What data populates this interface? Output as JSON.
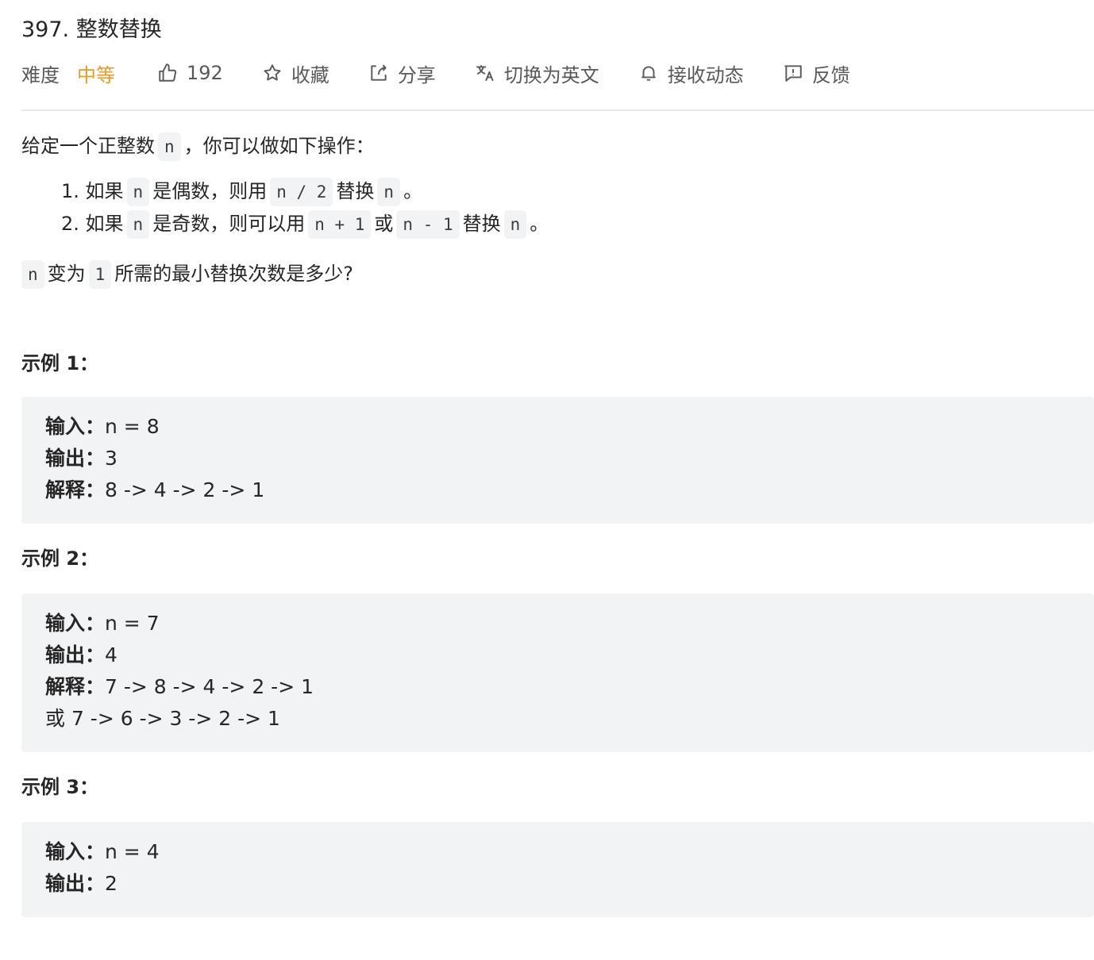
{
  "problem": {
    "title": "397. 整数替换"
  },
  "meta": {
    "difficulty_label": "难度",
    "difficulty_value": "中等",
    "likes": "192",
    "favorite": "收藏",
    "share": "分享",
    "translate": "切换为英文",
    "subscribe": "接收动态",
    "feedback": "反馈"
  },
  "colors": {
    "difficulty_medium": "#ef9b1f",
    "code_bg": "#f2f3f5",
    "text": "#262626"
  },
  "description": {
    "intro_prefix": "给定一个正整数",
    "intro_var": "n",
    "intro_suffix": "，你可以做如下操作：",
    "rules": [
      {
        "num": "1.",
        "t1": "如果",
        "c1": "n",
        "t2": "是偶数，则用",
        "c2": "n / 2",
        "t3": "替换",
        "c3": "n",
        "t4": "。"
      },
      {
        "num": "2.",
        "t1": "如果",
        "c1": "n",
        "t2": "是奇数，则可以用",
        "c2": "n + 1",
        "t3": "或",
        "c3": "n - 1",
        "t4": "替换",
        "c4": "n",
        "t5": "。"
      }
    ],
    "question_var": "n",
    "question_mid": "变为",
    "question_num": "1",
    "question_suffix": "所需的最小替换次数是多少?"
  },
  "examples": [
    {
      "heading": "示例 1：",
      "rows": [
        {
          "key": "输入：",
          "value": "n = 8"
        },
        {
          "key": "输出：",
          "value": "3"
        },
        {
          "key": "解释：",
          "value": "8 -> 4 -> 2 -> 1"
        }
      ]
    },
    {
      "heading": "示例 2：",
      "rows": [
        {
          "key": "输入：",
          "value": "n = 7"
        },
        {
          "key": "输出：",
          "value": "4"
        },
        {
          "key": "解释：",
          "value": "7 -> 8 -> 4 -> 2 -> 1"
        },
        {
          "key": "",
          "value": "或 7 -> 6 -> 3 -> 2 -> 1"
        }
      ]
    },
    {
      "heading": "示例 3：",
      "rows": [
        {
          "key": "输入：",
          "value": "n = 4"
        },
        {
          "key": "输出：",
          "value": "2"
        }
      ]
    }
  ]
}
